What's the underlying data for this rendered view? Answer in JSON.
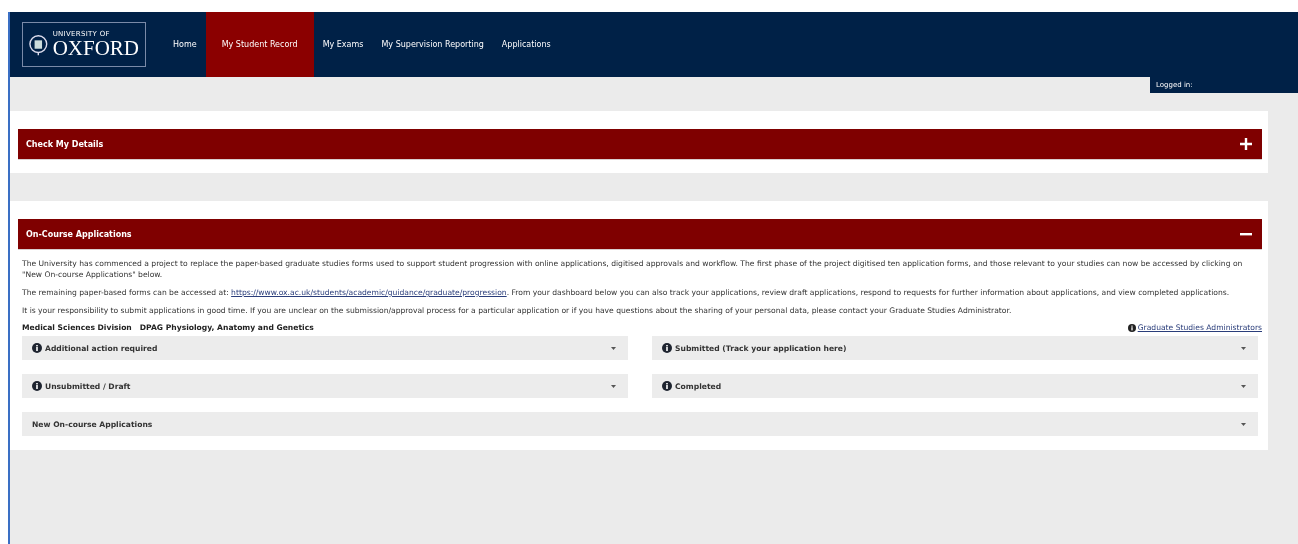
{
  "logo": {
    "line1": "UNIVERSITY OF",
    "line2": "OXFORD"
  },
  "nav": [
    {
      "label": "Home",
      "selected": false
    },
    {
      "label": "My Student Record",
      "selected": true
    },
    {
      "label": "My Exams",
      "selected": false
    },
    {
      "label": "My Supervision Reporting",
      "selected": false
    },
    {
      "label": "Applications",
      "selected": false
    }
  ],
  "logged_in": "Logged in:",
  "panels": [
    {
      "title": "Check My Details",
      "expanded": false
    },
    {
      "title": "On-Course Applications",
      "expanded": true
    }
  ],
  "intro": [
    "The University has commenced a project to replace the paper-based graduate studies forms used to support student progression with online applications, digitised approvals and workflow. The first phase of the project digitised ten application forms, and those relevant to your studies can now be accessed by clicking on \"New On-course Applications\" below.",
    "The remaining paper-based forms can be accessed at: ",
    "It is your responsibility to submit applications in good time. If you are unclear on the submission/approval process for a particular application or if you have questions about the sharing of your personal data, please contact your Graduate Studies Administrator."
  ],
  "forms_link": "https://www.ox.ac.uk/students/academic/guidance/graduate/progression",
  "forms_after": ". From your dashboard below you can also track your applications, review draft applications, respond to requests for further information about applications, and view completed applications.",
  "division": "Medical Sciences Division",
  "department": "DPAG Physiology, Anatomy and Genetics",
  "admin_link": "Graduate Studies Administrators",
  "sections": [
    {
      "label": "Additional action required",
      "info": true
    },
    {
      "label": "Submitted (Track your application here)",
      "info": true
    },
    {
      "label": "Unsubmitted / Draft",
      "info": true
    },
    {
      "label": "Completed",
      "info": true
    },
    {
      "label": "New On-course Applications",
      "info": false
    }
  ]
}
